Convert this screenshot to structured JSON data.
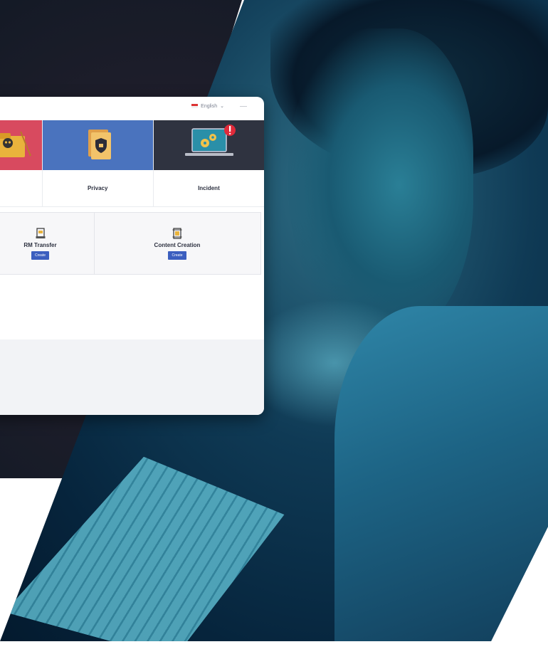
{
  "header": {
    "language": "English",
    "language_caret": "⌄"
  },
  "tiles": [
    {
      "label": "",
      "icon": "folder-skull-icon"
    },
    {
      "label": "Privacy",
      "icon": "lock-folder-icon"
    },
    {
      "label": "Incident",
      "icon": "gears-laptop-icon"
    }
  ],
  "cards": [
    {
      "title": "RM Transfer",
      "button": "Create",
      "icon": "document-scanner-icon"
    },
    {
      "title": "Content Creation",
      "button": "Create",
      "icon": "layered-document-icon"
    }
  ],
  "colors": {
    "tile_red": "#d84a5f",
    "tile_blue": "#4a73be",
    "tile_dark": "#2f3340",
    "button_blue": "#3c5fbf",
    "alert_red": "#e02a3a"
  }
}
